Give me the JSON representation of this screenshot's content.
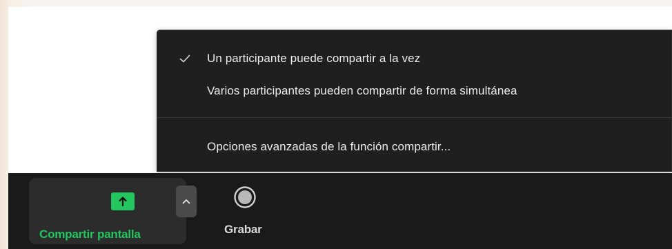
{
  "menu": {
    "items": [
      {
        "label": "Un participante puede compartir a la vez",
        "checked": true
      },
      {
        "label": "Varios participantes pueden compartir de forma simultánea",
        "checked": false
      },
      {
        "label": "Opciones avanzadas de la función compartir...",
        "checked": false
      }
    ]
  },
  "toolbar": {
    "share_label": "Compartir pantalla",
    "share_icon": "arrow-up-icon",
    "options_icon": "chevron-up-icon",
    "record_label": "Grabar",
    "record_icon": "record-icon"
  },
  "colors": {
    "accent_green": "#22c55e",
    "menu_bg": "#1f1f1f",
    "toolbar_bg": "#1a1a1a"
  }
}
